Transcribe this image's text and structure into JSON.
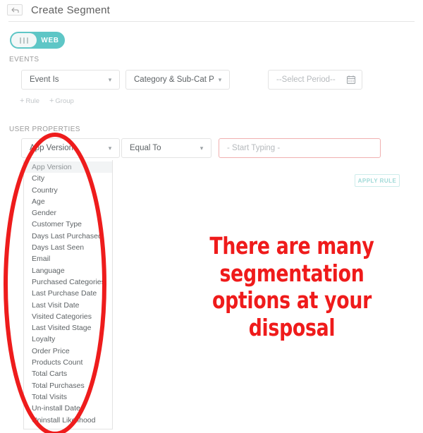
{
  "header": {
    "back_icon": "back-arrow-icon",
    "title": "Create Segment"
  },
  "platform_toggle": {
    "label": "WEB",
    "accent_color": "#5ec6c6",
    "state": "on"
  },
  "events": {
    "section_label": "EVENTS",
    "operator": {
      "value": "Event Is",
      "caret_icon": "chevron-down-icon"
    },
    "event": {
      "value": "Category & Sub-Cat Page",
      "caret_icon": "chevron-down-icon"
    },
    "period": {
      "value": "--Select Period--",
      "icon": "calendar-icon"
    },
    "add_rule_label": "Rule",
    "add_group_label": "Group",
    "plus_glyph": "+"
  },
  "user_properties": {
    "section_label": "USER PROPERTIES",
    "property": {
      "value": "App Version",
      "caret_icon": "chevron-down-icon"
    },
    "operator": {
      "value": "Equal To",
      "caret_icon": "chevron-down-icon"
    },
    "value_input": {
      "placeholder": "- Start Typing -",
      "value": "",
      "border_color": "#f0b0b0"
    },
    "apply_rule_label": "APPLY RULE",
    "apply_rule_color": "#9fd9d7"
  },
  "property_dropdown": {
    "selected": "App Version",
    "options": [
      "App Version",
      "City",
      "Country",
      "Age",
      "Gender",
      "Customer Type",
      "Days Last Purchased",
      "Days Last Seen",
      "Email",
      "Language",
      "Purchased Categories",
      "Last Purchase Date",
      "Last Visit Date",
      "Visited Categories",
      "Last Visited Stage",
      "Loyalty",
      "Order Price",
      "Products Count",
      "Total Carts",
      "Total Purchases",
      "Total Visits",
      "Un-install Date",
      "Uninstall Likelihood"
    ]
  },
  "annotation": {
    "text": "There are many segmentation options at your disposal",
    "color": "#ef1b1b",
    "ellipse_color": "#ee1c1c"
  }
}
